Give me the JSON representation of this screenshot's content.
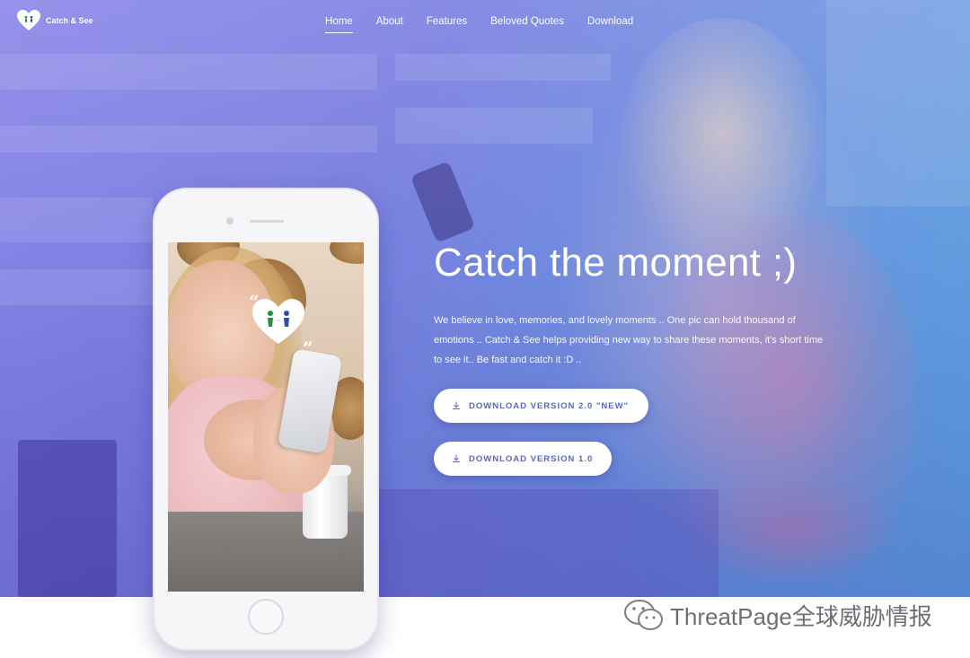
{
  "brand": {
    "name": "Catch & See"
  },
  "nav": {
    "items": [
      {
        "label": "Home",
        "active": true
      },
      {
        "label": "About",
        "active": false
      },
      {
        "label": "Features",
        "active": false
      },
      {
        "label": "Beloved Quotes",
        "active": false
      },
      {
        "label": "Download",
        "active": false
      }
    ]
  },
  "hero": {
    "headline": "Catch the moment ;)",
    "description": "We believe in love, memories, and lovely moments .. One pic can hold thousand of emotions .. Catch & See helps providing new way to share these moments, it's short time to see it.. Be fast and catch it :D ..",
    "buttons": [
      {
        "label": "DOWNLOAD VERSION 2.0 \"NEW\"",
        "icon": "download-icon"
      },
      {
        "label": "DOWNLOAD VERSION 1.0",
        "icon": "download-icon"
      }
    ]
  },
  "phone_screen": {
    "quote_open": "“",
    "quote_close": "”"
  },
  "watermark": {
    "text": "ThreatPage全球威胁情报",
    "icon": "wechat-icon"
  },
  "colors": {
    "hero_gradient_start": "#8a86e8",
    "hero_gradient_end": "#5aa6df",
    "button_text": "#5a67c8",
    "white": "#ffffff"
  }
}
